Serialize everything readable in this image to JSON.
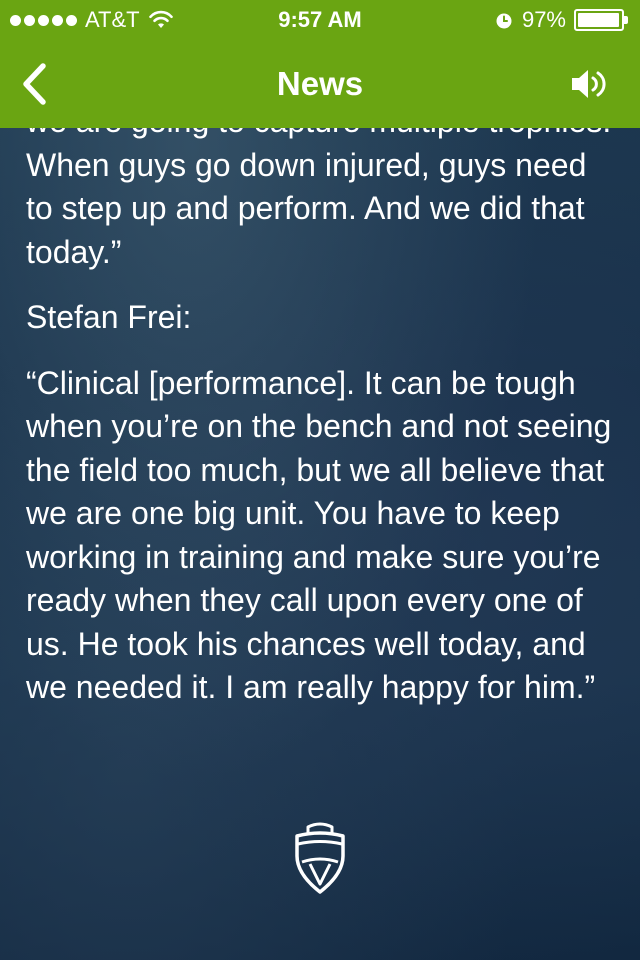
{
  "status_bar": {
    "carrier": "AT&T",
    "time": "9:57 AM",
    "battery": "97%",
    "battery_level": 0.97
  },
  "nav": {
    "title": "News"
  },
  "article": {
    "paragraphs": [
      "we are going to capture multiple trophies. When guys go down injured, guys need to step up and perform. And we did that today.”",
      "Stefan Frei:",
      "“Clinical [performance]. It can be tough when you’re on the bench and not seeing the field too much, but we all believe that we are one big unit. You have to keep working in training and make sure you’re ready when they call upon every one of us. He took his chances well today, and we needed it. I am really happy for him.”"
    ]
  },
  "icons": {
    "back": "chevron-left-icon",
    "sound": "speaker-icon",
    "wifi": "wifi-icon",
    "alarm": "alarm-icon",
    "logo": "club-crest-icon"
  },
  "colors": {
    "bar_green": "#6aa512",
    "background": "#1a344d",
    "text": "#ffffff"
  }
}
